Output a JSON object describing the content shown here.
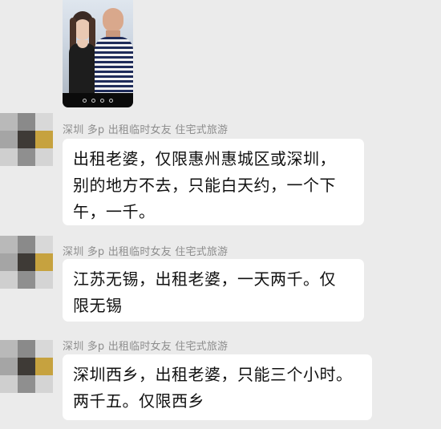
{
  "video_call": {
    "icon": "video-call-thumbnail"
  },
  "messages": [
    {
      "sender": "深圳 多p 出租临时女友 住宅式旅游",
      "lines": [
        "出租老婆，仅限惠州惠城区或深圳，",
        "别的地方不去，只能白天约，一个下",
        "午，一千。"
      ]
    },
    {
      "sender": "深圳 多p 出租临时女友 住宅式旅游",
      "lines": [
        "江苏无锡，出租老婆，一天两千。仅",
        "限无锡"
      ]
    },
    {
      "sender": "深圳 多p 出租临时女友 住宅式旅游",
      "lines": [
        "深圳西乡，出租老婆，只能三个小时。",
        "两千五。仅限西乡"
      ]
    }
  ],
  "colors": {
    "background": "#ebebeb",
    "bubble": "#ffffff",
    "sender_text": "#8d8d8d",
    "message_text": "#111111"
  }
}
